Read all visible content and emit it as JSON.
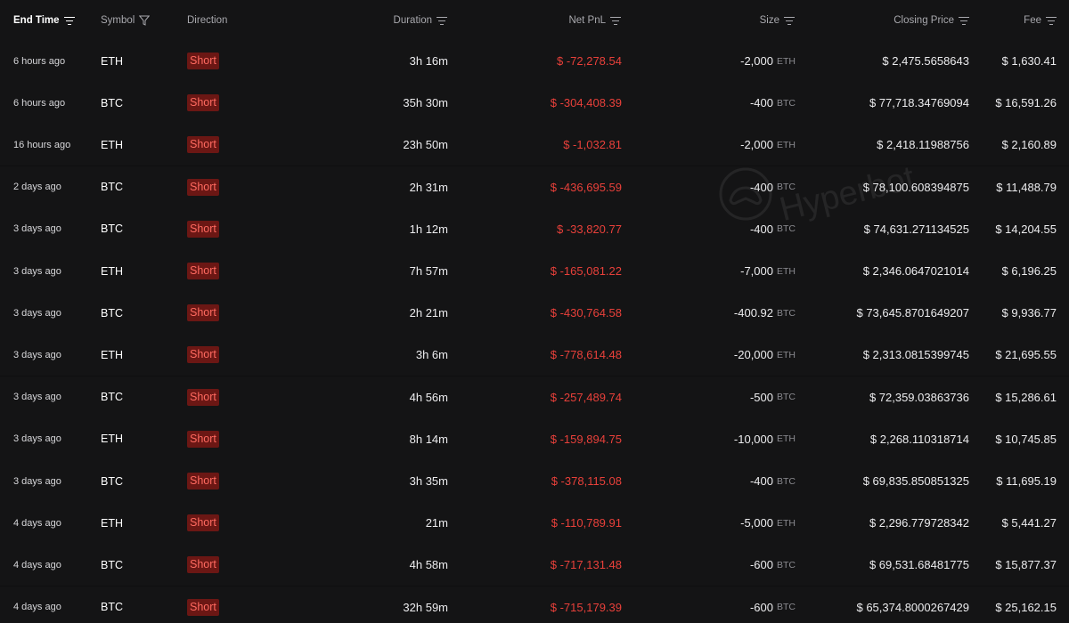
{
  "header": {
    "end_time": "End Time",
    "symbol": "Symbol",
    "direction": "Direction",
    "duration": "Duration",
    "net_pnl": "Net PnL",
    "size": "Size",
    "closing_price": "Closing Price",
    "fee": "Fee"
  },
  "colors": {
    "pnl_negative": "#e8403a",
    "short_badge_bg": "#6b1714",
    "short_badge_text": "#ff6a60",
    "row_bg": "#141415"
  },
  "watermark": "Hyperbot",
  "rows": [
    {
      "end_time": "6 hours ago",
      "symbol": "ETH",
      "direction": "Short",
      "duration": "3h 16m",
      "net_pnl": "$ -72,278.54",
      "size": "-2,000",
      "size_unit": "ETH",
      "closing_price": "$ 2,475.5658643",
      "fee": "$ 1,630.41"
    },
    {
      "end_time": "6 hours ago",
      "symbol": "BTC",
      "direction": "Short",
      "duration": "35h 30m",
      "net_pnl": "$ -304,408.39",
      "size": "-400",
      "size_unit": "BTC",
      "closing_price": "$ 77,718.34769094",
      "fee": "$ 16,591.26"
    },
    {
      "end_time": "16 hours ago",
      "symbol": "ETH",
      "direction": "Short",
      "duration": "23h 50m",
      "net_pnl": "$ -1,032.81",
      "size": "-2,000",
      "size_unit": "ETH",
      "closing_price": "$ 2,418.11988756",
      "fee": "$ 2,160.89"
    },
    {
      "end_time": "2 days ago",
      "symbol": "BTC",
      "direction": "Short",
      "duration": "2h 31m",
      "net_pnl": "$ -436,695.59",
      "size": "-400",
      "size_unit": "BTC",
      "closing_price": "$ 78,100.608394875",
      "fee": "$ 11,488.79"
    },
    {
      "end_time": "3 days ago",
      "symbol": "BTC",
      "direction": "Short",
      "duration": "1h 12m",
      "net_pnl": "$ -33,820.77",
      "size": "-400",
      "size_unit": "BTC",
      "closing_price": "$ 74,631.271134525",
      "fee": "$ 14,204.55"
    },
    {
      "end_time": "3 days ago",
      "symbol": "ETH",
      "direction": "Short",
      "duration": "7h 57m",
      "net_pnl": "$ -165,081.22",
      "size": "-7,000",
      "size_unit": "ETH",
      "closing_price": "$ 2,346.0647021014",
      "fee": "$ 6,196.25"
    },
    {
      "end_time": "3 days ago",
      "symbol": "BTC",
      "direction": "Short",
      "duration": "2h 21m",
      "net_pnl": "$ -430,764.58",
      "size": "-400.92",
      "size_unit": "BTC",
      "closing_price": "$ 73,645.8701649207",
      "fee": "$ 9,936.77"
    },
    {
      "end_time": "3 days ago",
      "symbol": "ETH",
      "direction": "Short",
      "duration": "3h 6m",
      "net_pnl": "$ -778,614.48",
      "size": "-20,000",
      "size_unit": "ETH",
      "closing_price": "$ 2,313.0815399745",
      "fee": "$ 21,695.55"
    },
    {
      "end_time": "3 days ago",
      "symbol": "BTC",
      "direction": "Short",
      "duration": "4h 56m",
      "net_pnl": "$ -257,489.74",
      "size": "-500",
      "size_unit": "BTC",
      "closing_price": "$ 72,359.03863736",
      "fee": "$ 15,286.61"
    },
    {
      "end_time": "3 days ago",
      "symbol": "ETH",
      "direction": "Short",
      "duration": "8h 14m",
      "net_pnl": "$ -159,894.75",
      "size": "-10,000",
      "size_unit": "ETH",
      "closing_price": "$ 2,268.110318714",
      "fee": "$ 10,745.85"
    },
    {
      "end_time": "3 days ago",
      "symbol": "BTC",
      "direction": "Short",
      "duration": "3h 35m",
      "net_pnl": "$ -378,115.08",
      "size": "-400",
      "size_unit": "BTC",
      "closing_price": "$ 69,835.850851325",
      "fee": "$ 11,695.19"
    },
    {
      "end_time": "4 days ago",
      "symbol": "ETH",
      "direction": "Short",
      "duration": "21m",
      "net_pnl": "$ -110,789.91",
      "size": "-5,000",
      "size_unit": "ETH",
      "closing_price": "$ 2,296.779728342",
      "fee": "$ 5,441.27"
    },
    {
      "end_time": "4 days ago",
      "symbol": "BTC",
      "direction": "Short",
      "duration": "4h 58m",
      "net_pnl": "$ -717,131.48",
      "size": "-600",
      "size_unit": "BTC",
      "closing_price": "$ 69,531.68481775",
      "fee": "$ 15,877.37"
    },
    {
      "end_time": "4 days ago",
      "symbol": "BTC",
      "direction": "Short",
      "duration": "32h 59m",
      "net_pnl": "$ -715,179.39",
      "size": "-600",
      "size_unit": "BTC",
      "closing_price": "$ 65,374.8000267429",
      "fee": "$ 25,162.15"
    }
  ]
}
